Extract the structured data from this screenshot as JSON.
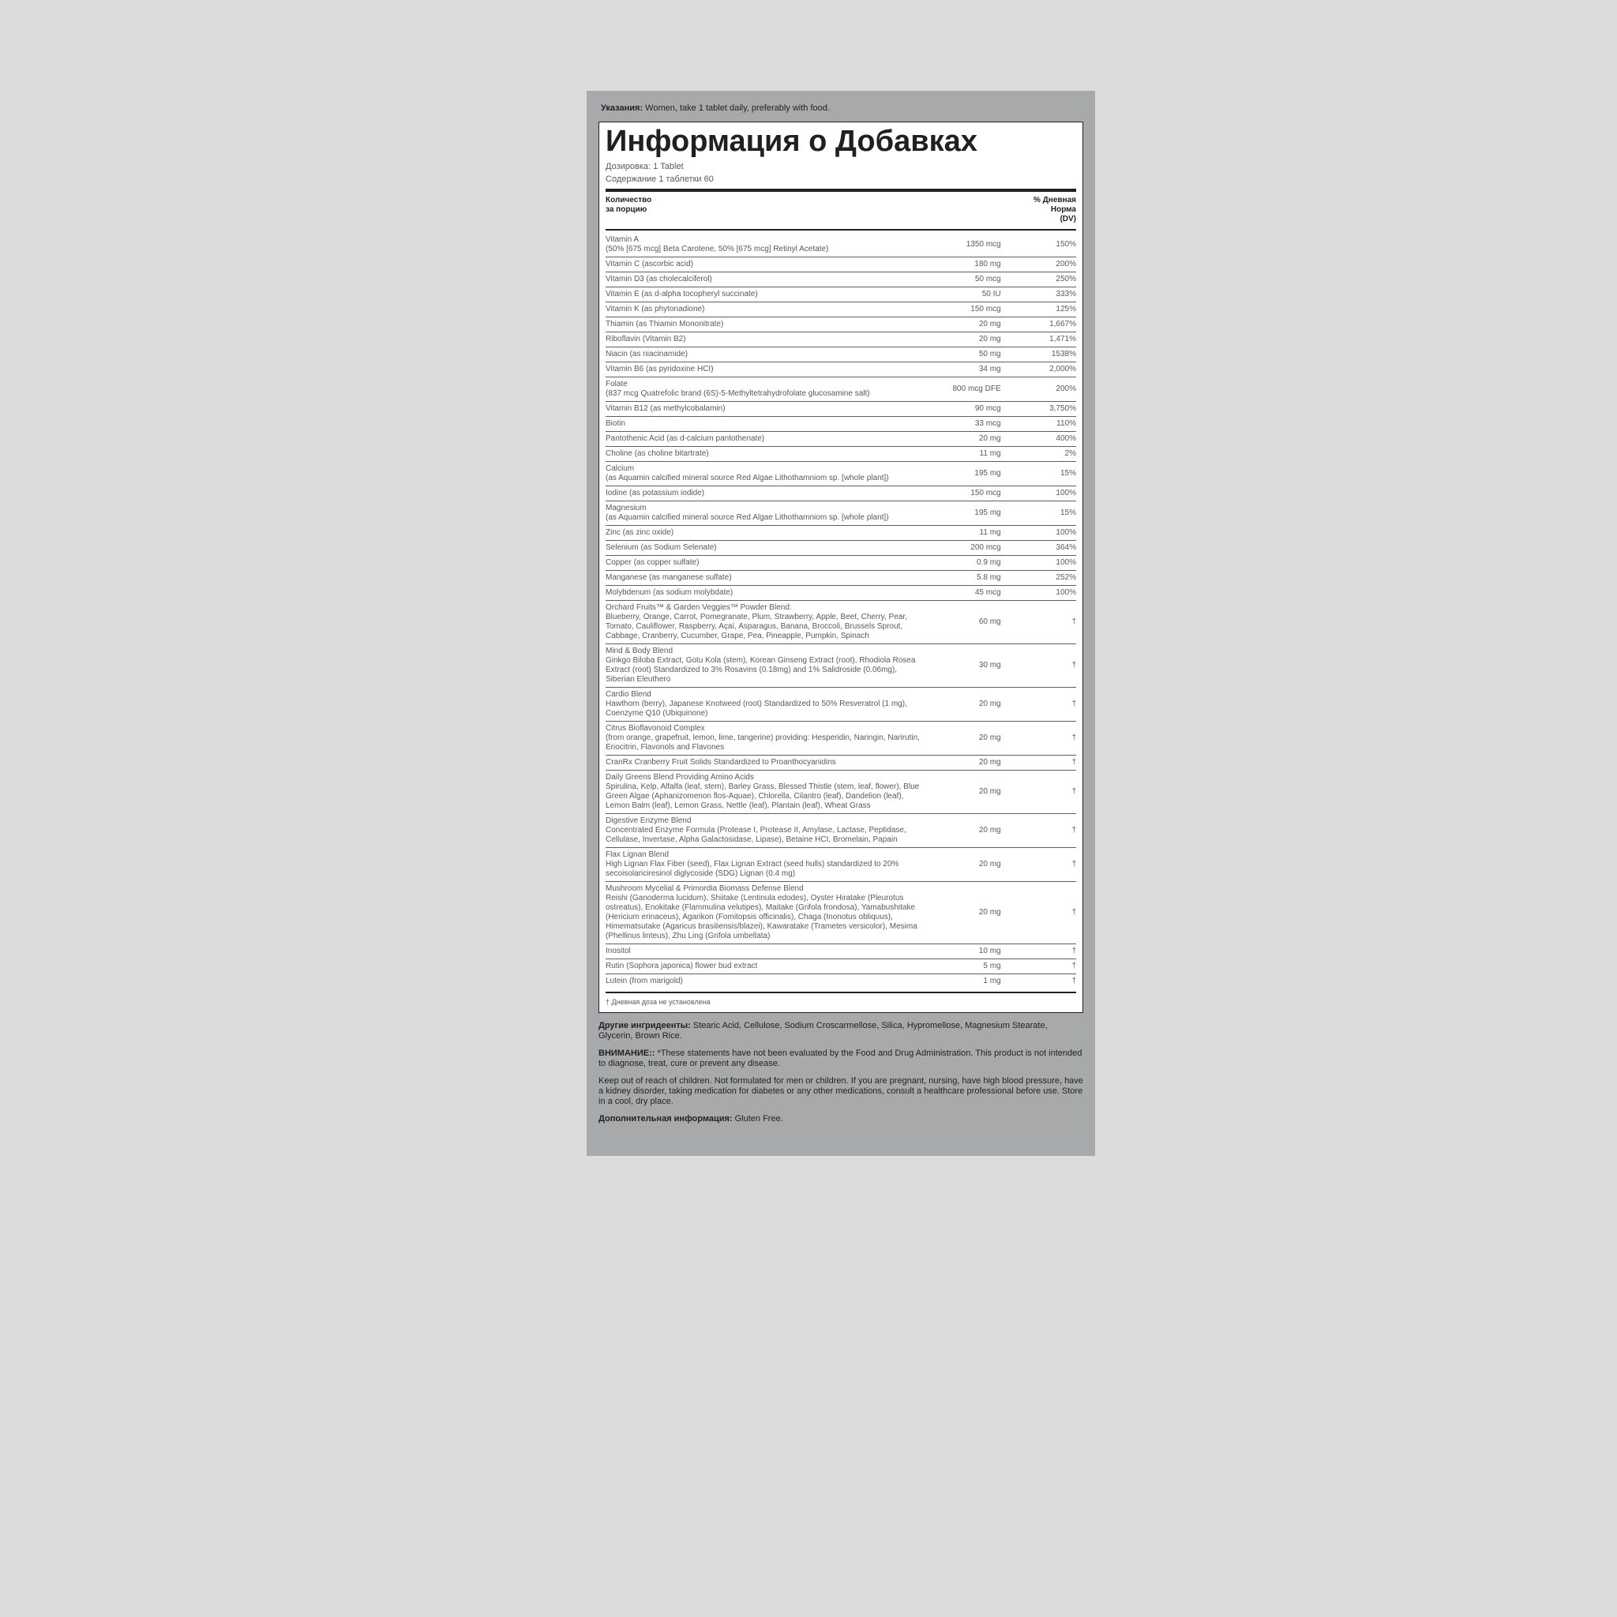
{
  "directions": {
    "label": "Указания:",
    "text": " Women, take 1 tablet daily, preferably with food."
  },
  "title": "Информация о Добавках",
  "serving_size": {
    "label": "Дозировка:",
    "value": " 1 Tablet"
  },
  "servings_per": {
    "label": "Содержание 1 таблетки",
    "value": " 60"
  },
  "header": {
    "amount1": "Количество",
    "amount2": "за порцию",
    "dv1": "% Дневная",
    "dv2": "Норма",
    "dv3": "(DV)"
  },
  "rows": [
    {
      "name": "Vitamin A",
      "sub": "(50% [675 mcg] Beta Carotene, 50% [675 mcg] Retinyl Acetate)",
      "amt": "1350 mcg",
      "dv": "150%"
    },
    {
      "name": "Vitamin C (ascorbic acid)",
      "amt": "180 mg",
      "dv": "200%"
    },
    {
      "name": "Vitamin D3 (as cholecalciferol)",
      "amt": "50 mcg",
      "dv": "250%"
    },
    {
      "name": "Vitamin E (as d-alpha tocopheryl succinate)",
      "amt": "50 IU",
      "dv": "333%"
    },
    {
      "name": "Vitamin K (as phytonadione)",
      "amt": "150 mcg",
      "dv": "125%"
    },
    {
      "name": "Thiamin (as Thiamin Mononitrate)",
      "amt": "20 mg",
      "dv": "1,667%"
    },
    {
      "name": "Riboflavin (Vitamin B2)",
      "amt": "20 mg",
      "dv": "1,471%"
    },
    {
      "name": "Niacin (as niacinamide)",
      "amt": "50 mg",
      "dv": "1538%"
    },
    {
      "name": "Vitamin B6 (as pyridoxine HCI)",
      "amt": "34 mg",
      "dv": "2,000%"
    },
    {
      "name": "Folate",
      "sub": "(837 mcg Quatrefolic brand (6S)-5-Methyltetrahydrofolate glucosamine salt)",
      "amt": "800 mcg DFE",
      "dv": "200%"
    },
    {
      "name": "Vitamin B12 (as methylcobalamin)",
      "amt": "90 mcg",
      "dv": "3,750%"
    },
    {
      "name": "Biotin",
      "amt": "33 mcg",
      "dv": "110%"
    },
    {
      "name": "Pantothenic Acid (as d-calcium pantothenate)",
      "amt": "20 mg",
      "dv": "400%"
    },
    {
      "name": "Choline (as choline bitartrate)",
      "amt": "11 mg",
      "dv": "2%"
    },
    {
      "name": "Calcium",
      "sub": "(as Aquamin calcified mineral source Red Algae Lithothamniom sp. [whole plant])",
      "amt": "195 mg",
      "dv": "15%"
    },
    {
      "name": "Iodine (as potassium iodide)",
      "amt": "150 mcg",
      "dv": "100%"
    },
    {
      "name": "Magnesium",
      "sub": "(as Aquamin calcified mineral source Red Algae Lithothamniom sp. [whole plant])",
      "amt": "195 mg",
      "dv": "15%"
    },
    {
      "name": "Zinc (as zinc oxide)",
      "amt": "11 mg",
      "dv": "100%"
    },
    {
      "name": "Selenium (as Sodium Selenate)",
      "amt": "200 mcg",
      "dv": "364%"
    },
    {
      "name": "Copper (as copper sulfate)",
      "amt": "0.9 mg",
      "dv": "100%"
    },
    {
      "name": "Manganese (as manganese sulfate)",
      "amt": "5.8 mg",
      "dv": "252%"
    },
    {
      "name": "Molybdenum (as sodium molybdate)",
      "amt": "45 mcg",
      "dv": "100%"
    },
    {
      "name": "Orchard Fruits™ & Garden Veggies™ Powder Blend:",
      "sub": "Blueberry, Orange, Carrot, Pomegranate, Plum, Strawberry, Apple, Beet, Cherry, Pear, Tomato, Cauliflower, Raspberry, Açaí, Asparagus, Banana, Broccoli, Brussels Sprout, Cabbage, Cranberry, Cucumber, Grape, Pea, Pineapple, Pumpkin, Spinach",
      "amt": "60 mg",
      "dv": "†"
    },
    {
      "name": "Mind & Body Blend",
      "sub": "Ginkgo Biloba Extract, Gotu Kola (stem), Korean Ginseng Extract (root), Rhodiola Rosea Extract (root) Standardized to 3% Rosavins (0.18mg) and 1% Salidroside (0.06mg), Siberian Eleuthero",
      "amt": "30 mg",
      "dv": "†"
    },
    {
      "name": "Cardio Blend",
      "sub": "Hawthorn (berry), Japanese Knotweed (root) Standardized to 50% Resveratrol (1 mg), Coenzyme Q10 (Ubiquinone)",
      "amt": "20 mg",
      "dv": "†"
    },
    {
      "name": "Citrus Bioflavonoid Complex",
      "sub": "(from orange, grapefruit, lemon, lime, tangerine) providing: Hesperidin, Naringin, Narirutin, Eriocitrin, Flavonols and Flavones",
      "amt": "20 mg",
      "dv": "†"
    },
    {
      "name": "CranRx Cranberry Fruit Solids Standardized to Proanthocyanidins",
      "amt": "20 mg",
      "dv": "†"
    },
    {
      "name": "Daily Greens Blend Providing Amino Acids",
      "sub": "Spirulina, Kelp, Alfalfa (leaf, stem), Barley Grass, Blessed Thistle (stem, leaf, flower), Blue Green Algae (Aphanizomenon flos-Aquae), Chlorella, Cilantro (leaf), Dandelion (leaf), Lemon Balm (leaf), Lemon Grass, Nettle (leaf), Plantain (leaf), Wheat Grass",
      "amt": "20 mg",
      "dv": "†"
    },
    {
      "name": "Digestive Enzyme Blend",
      "sub": "Concentrated Enzyme Formula (Protease I, Protease II, Amylase, Lactase, Peptidase, Cellulase, Invertase, Alpha Galactosidase, Lipase), Betaine HCI, Bromelain, Papain",
      "amt": "20 mg",
      "dv": "†"
    },
    {
      "name": "Flax Lignan Blend",
      "sub": "High Lignan Flax Fiber (seed), Flax Lignan Extract (seed hulls) standardized to 20% secoisolariciresinol diglycoside (SDG) Lignan (0.4 mg)",
      "amt": "20 mg",
      "dv": "†"
    },
    {
      "name": "Mushroom Mycelial & Primordia Biomass Defense Blend",
      "sub": "Reishi (Ganoderma lucidum), Shiitake (Lentinula edodes), Oyster Hiratake (Pleurotus ostreatus), Enokitake (Flammulina velutipes), Maitake (Grifola frondosa), Yamabushitake (Hericium erinaceus), Agarikon (Fomitopsis officinalis), Chaga (Inonotus obliquus), Himematsutake (Agaricus brasiliensis/blazei), Kawaratake (Trametes versicolor), Mesima (Phellinus linteus), Zhu Ling (Grifola umbellata)",
      "amt": "20 mg",
      "dv": "†"
    },
    {
      "name": "Inositol",
      "amt": "10 mg",
      "dv": "†"
    },
    {
      "name": "Rutin (Sophora japonica) flower bud extract",
      "amt": "5 mg",
      "dv": "†"
    },
    {
      "name": "Lutein (from marigold)",
      "amt": "1 mg",
      "dv": "†"
    }
  ],
  "dagger_note": "† Дневная доза не установлена",
  "other": {
    "label": "Другие ингридеенты:",
    "text": " Stearic Acid, Cellulose, Sodium Croscarmellose, Silica, Hypromellose, Magnesium Stearate, Glycerin, Brown Rice."
  },
  "warning": {
    "label": "ВНИМАНИЕ::",
    "text": " *These statements have not been evaluated by the Food and Drug Administration. This product is not intended to diagnose, treat, cure or prevent any disease."
  },
  "keepout": "Keep out of reach of children. Not formulated for men or children. If you are pregnant, nursing, have high blood pressure, have a kidney disorder, taking medication for diabetes or any other medications, consult a healthcare professional before use. Store in a cool, dry place.",
  "addl": {
    "label": "Дополнительная информация:",
    "text": " Gluten Free."
  }
}
